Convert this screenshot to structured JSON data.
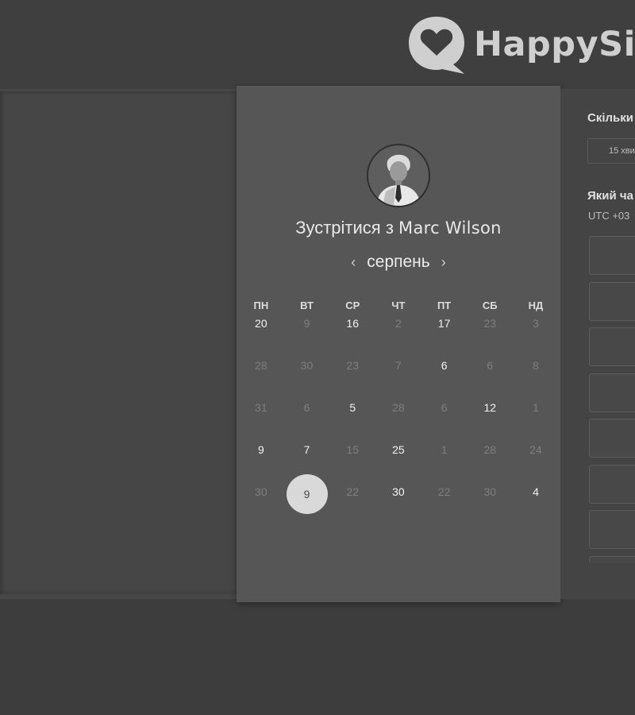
{
  "brand": {
    "name": "HappySig",
    "logo_icon": "heart-speech-bubble-icon"
  },
  "scheduler": {
    "avatar_icon": "user-avatar",
    "title_prefix": "Зустрітися з",
    "host_name": "Marc Wilson",
    "month": "серпень",
    "prev_icon": "chevron-left-icon",
    "next_icon": "chevron-right-icon",
    "weekdays": [
      "ПН",
      "ВТ",
      "СР",
      "ЧТ",
      "ПТ",
      "СБ",
      "НД"
    ],
    "weeks": [
      [
        {
          "d": "20",
          "on": true
        },
        {
          "d": "9",
          "on": false
        },
        {
          "d": "16",
          "on": true
        },
        {
          "d": "2",
          "on": false
        },
        {
          "d": "17",
          "on": true
        },
        {
          "d": "23",
          "on": false
        },
        {
          "d": "3",
          "on": false
        }
      ],
      [
        {
          "d": "28",
          "on": false
        },
        {
          "d": "30",
          "on": false
        },
        {
          "d": "23",
          "on": false
        },
        {
          "d": "7",
          "on": false
        },
        {
          "d": "6",
          "on": true
        },
        {
          "d": "6",
          "on": false
        },
        {
          "d": "8",
          "on": false
        }
      ],
      [
        {
          "d": "31",
          "on": false
        },
        {
          "d": "6",
          "on": false
        },
        {
          "d": "5",
          "on": true
        },
        {
          "d": "28",
          "on": false
        },
        {
          "d": "6",
          "on": false
        },
        {
          "d": "12",
          "on": true
        },
        {
          "d": "1",
          "on": false
        }
      ],
      [
        {
          "d": "9",
          "on": true
        },
        {
          "d": "7",
          "on": true
        },
        {
          "d": "15",
          "on": false
        },
        {
          "d": "25",
          "on": true
        },
        {
          "d": "1",
          "on": false
        },
        {
          "d": "28",
          "on": false
        },
        {
          "d": "24",
          "on": false
        }
      ],
      [
        {
          "d": "30",
          "on": false
        },
        {
          "d": "9",
          "on": true,
          "selected": true
        },
        {
          "d": "22",
          "on": false
        },
        {
          "d": "30",
          "on": true
        },
        {
          "d": "22",
          "on": false
        },
        {
          "d": "30",
          "on": false
        },
        {
          "d": "4",
          "on": true
        }
      ]
    ]
  },
  "sidebar": {
    "duration_question": "Скільки",
    "duration_value": "15 хви",
    "time_question": "Який ча",
    "timezone": "UTC +03",
    "slot_count": 7
  }
}
